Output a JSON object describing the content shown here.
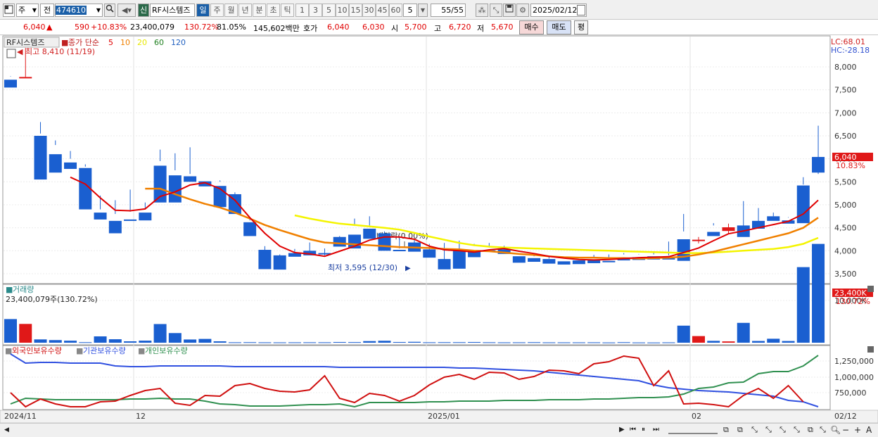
{
  "toolbar": {
    "period_ju": "주",
    "jeon": "전",
    "code": "474610",
    "sin": "신",
    "name": "RF시스템즈",
    "periods": [
      "일",
      "주",
      "월",
      "년",
      "분",
      "초",
      "틱"
    ],
    "minutes": [
      "1",
      "3",
      "5",
      "10",
      "15",
      "30",
      "45",
      "60"
    ],
    "minute_value": "5",
    "count": "55/55",
    "date": "2025/02/12"
  },
  "info": {
    "price": "6,040",
    "change": "590",
    "change_pct": "+10.83%",
    "volume": "23,400,079",
    "vol_ratio": "130.72%",
    "strength": "81.05%",
    "amount": "145,602백만",
    "hoga_label": "호가",
    "ask": "6,040",
    "bid": "6,030",
    "open_label": "시",
    "open": "5,700",
    "high_label": "고",
    "high": "6,720",
    "low_label": "저",
    "low": "5,670",
    "buy": "매수",
    "sell": "매도",
    "avg": "평"
  },
  "legend": {
    "name": "RF시스템즈",
    "ma_prefix": "종가 단순",
    "ma": [
      {
        "label": "5",
        "color": "#e00000"
      },
      {
        "label": "10",
        "color": "#f08000"
      },
      {
        "label": "20",
        "color": "#e8e800"
      },
      {
        "label": "60",
        "color": "#208020"
      },
      {
        "label": "120",
        "color": "#2060c0"
      }
    ],
    "max_label": "최고 8,410 (11/19)",
    "min_label": "최저 3,595 (12/30)",
    "dividend": "배당락(0.00%)",
    "lc": "LC:68.01",
    "hc": "HC:-28.18",
    "last_price": "6,040",
    "last_pct": "10.83%"
  },
  "volume_panel": {
    "title": "거래량",
    "value": "23,400,079주(130.72%)",
    "badge": "23,400K",
    "pct": "130.72%",
    "tick": "10,000K"
  },
  "holdings": {
    "foreign": "외국인보유수량",
    "institution": "기관보유수량",
    "individual": "개인보유수량",
    "ticks": [
      "1,250,000",
      "1,000,000",
      "750,000"
    ],
    "colors": {
      "foreign": "#d01010",
      "institution": "#3050e0",
      "individual": "#309050"
    }
  },
  "xaxis": {
    "labels": [
      "2024/11",
      "12",
      "2025/01",
      "02"
    ],
    "end": "02/12"
  },
  "price_axis": [
    "8,000",
    "7,500",
    "7,000",
    "6,500",
    "6,000",
    "5,500",
    "5,000",
    "4,500",
    "4,000",
    "3,500"
  ],
  "colors": {
    "up": "#e01818",
    "down": "#1a5fd0",
    "ma5": "#e00000",
    "ma10": "#f08000",
    "ma20": "#f4f400"
  },
  "chart_data": {
    "type": "candlestick",
    "candles": [
      [
        7720,
        7800,
        7790,
        7550
      ],
      [
        7750,
        8410,
        7780,
        7780
      ],
      [
        6500,
        6800,
        6550,
        5550
      ],
      [
        6100,
        6300,
        6400,
        5700
      ],
      [
        5920,
        6000,
        6170,
        5780
      ],
      [
        5800,
        5880,
        5830,
        4900
      ],
      [
        4830,
        5200,
        4900,
        4680
      ],
      [
        4650,
        5100,
        4800,
        4380
      ],
      [
        4680,
        5330,
        4850,
        4650
      ],
      [
        4830,
        5050,
        4920,
        4660
      ],
      [
        5850,
        6200,
        5950,
        5050
      ],
      [
        5640,
        6120,
        5750,
        5050
      ],
      [
        5620,
        6250,
        5670,
        5500
      ],
      [
        5510,
        5550,
        5550,
        5400
      ],
      [
        5410,
        5500,
        5530,
        4950
      ],
      [
        5230,
        5270,
        5230,
        4800
      ],
      [
        4620,
        4660,
        4700,
        4320
      ],
      [
        4020,
        4100,
        4000,
        3600
      ],
      [
        3900,
        3920,
        3680,
        3590
      ],
      [
        3950,
        4040,
        3910,
        3870
      ],
      [
        4000,
        4180,
        3910,
        3900
      ],
      [
        3950,
        4050,
        3900,
        3920
      ],
      [
        4300,
        4320,
        4290,
        4090
      ],
      [
        4350,
        4700,
        4540,
        4050
      ],
      [
        4480,
        4550,
        4750,
        4260
      ],
      [
        4380,
        4420,
        4390,
        4000
      ],
      [
        4020,
        4050,
        4270,
        4000
      ],
      [
        4180,
        4250,
        4170,
        3980
      ],
      [
        4030,
        4150,
        3900,
        3850
      ],
      [
        3820,
        4170,
        3670,
        3595
      ],
      [
        4000,
        4220,
        3970,
        3610
      ],
      [
        4000,
        4120,
        4150,
        3860
      ],
      [
        4010,
        4170,
        4070,
        3990
      ],
      [
        4030,
        4110,
        3960,
        3930
      ],
      [
        3880,
        3940,
        3920,
        3740
      ],
      [
        3840,
        3910,
        3880,
        3760
      ],
      [
        3820,
        3830,
        3860,
        3720
      ],
      [
        3770,
        3860,
        3850,
        3700
      ],
      [
        3790,
        3830,
        3830,
        3710
      ],
      [
        3800,
        3910,
        3850,
        3730
      ],
      [
        3780,
        3920,
        3850,
        3760
      ],
      [
        3840,
        3920,
        3950,
        3790
      ],
      [
        3860,
        3930,
        3920,
        3800
      ],
      [
        3880,
        3980,
        3920,
        3810
      ],
      [
        3840,
        4200,
        3900,
        3810
      ],
      [
        4250,
        4800,
        4420,
        3780
      ],
      [
        4220,
        4300,
        4160,
        4240
      ],
      [
        4410,
        4600,
        4550,
        4320
      ],
      [
        4430,
        4590,
        4360,
        4510
      ],
      [
        4550,
        5080,
        4500,
        4300
      ],
      [
        4650,
        4930,
        4480,
        4480
      ],
      [
        4750,
        4750,
        4830,
        4650
      ],
      [
        4660,
        4730,
        4720,
        4590
      ],
      [
        5420,
        5440,
        5600,
        4600
      ],
      [
        6040,
        6720,
        5670,
        5700
      ]
    ],
    "volume_k": [
      5600,
      4450,
      780,
      620,
      480,
      120,
      1500,
      820,
      330,
      490,
      4420,
      2280,
      760,
      900,
      330,
      100,
      120,
      90,
      80,
      90,
      100,
      100,
      160,
      140,
      380,
      460,
      160,
      210,
      100,
      120,
      120,
      160,
      100,
      80,
      90,
      120,
      80,
      80,
      80,
      90,
      60,
      120,
      60,
      50,
      80,
      4040,
      1570,
      440,
      310,
      4700,
      410,
      940,
      400,
      17900,
      23400
    ],
    "ma5": [
      [
        4,
        5600
      ],
      [
        5,
        5450
      ],
      [
        6,
        5150
      ],
      [
        7,
        4880
      ],
      [
        8,
        4870
      ],
      [
        9,
        4910
      ],
      [
        10,
        5180
      ],
      [
        11,
        5280
      ],
      [
        12,
        5430
      ],
      [
        13,
        5480
      ],
      [
        14,
        5350
      ],
      [
        15,
        5100
      ],
      [
        16,
        4720
      ],
      [
        17,
        4380
      ],
      [
        18,
        4100
      ],
      [
        19,
        3960
      ],
      [
        20,
        3930
      ],
      [
        21,
        3880
      ],
      [
        22,
        3990
      ],
      [
        23,
        4100
      ],
      [
        24,
        4230
      ],
      [
        25,
        4300
      ],
      [
        26,
        4300
      ],
      [
        27,
        4250
      ],
      [
        28,
        4100
      ],
      [
        29,
        4020
      ],
      [
        30,
        4000
      ],
      [
        31,
        3970
      ],
      [
        32,
        4020
      ],
      [
        33,
        4050
      ],
      [
        34,
        3990
      ],
      [
        35,
        3940
      ],
      [
        36,
        3880
      ],
      [
        37,
        3840
      ],
      [
        38,
        3810
      ],
      [
        39,
        3800
      ],
      [
        40,
        3810
      ],
      [
        41,
        3830
      ],
      [
        42,
        3850
      ],
      [
        43,
        3860
      ],
      [
        44,
        3870
      ],
      [
        45,
        3960
      ],
      [
        46,
        4060
      ],
      [
        47,
        4220
      ],
      [
        48,
        4370
      ],
      [
        49,
        4430
      ],
      [
        50,
        4500
      ],
      [
        51,
        4570
      ],
      [
        52,
        4640
      ],
      [
        53,
        4800
      ],
      [
        54,
        5100
      ]
    ],
    "ma10": [
      [
        9,
        5350
      ],
      [
        10,
        5350
      ],
      [
        11,
        5230
      ],
      [
        12,
        5120
      ],
      [
        13,
        5020
      ],
      [
        14,
        4940
      ],
      [
        15,
        4830
      ],
      [
        16,
        4700
      ],
      [
        17,
        4560
      ],
      [
        18,
        4450
      ],
      [
        19,
        4350
      ],
      [
        20,
        4250
      ],
      [
        21,
        4180
      ],
      [
        22,
        4160
      ],
      [
        23,
        4140
      ],
      [
        24,
        4120
      ],
      [
        25,
        4100
      ],
      [
        26,
        4080
      ],
      [
        27,
        4070
      ],
      [
        28,
        4060
      ],
      [
        29,
        4040
      ],
      [
        30,
        4030
      ],
      [
        31,
        4000
      ],
      [
        32,
        3990
      ],
      [
        33,
        3960
      ],
      [
        34,
        3930
      ],
      [
        35,
        3910
      ],
      [
        36,
        3880
      ],
      [
        37,
        3860
      ],
      [
        38,
        3850
      ],
      [
        39,
        3850
      ],
      [
        40,
        3840
      ],
      [
        41,
        3840
      ],
      [
        42,
        3830
      ],
      [
        43,
        3840
      ],
      [
        44,
        3850
      ],
      [
        45,
        3870
      ],
      [
        46,
        3920
      ],
      [
        47,
        3980
      ],
      [
        48,
        4060
      ],
      [
        49,
        4140
      ],
      [
        50,
        4220
      ],
      [
        51,
        4300
      ],
      [
        52,
        4380
      ],
      [
        53,
        4500
      ],
      [
        54,
        4720
      ]
    ],
    "ma20": [
      [
        19,
        4770
      ],
      [
        20,
        4700
      ],
      [
        21,
        4640
      ],
      [
        22,
        4590
      ],
      [
        23,
        4560
      ],
      [
        24,
        4530
      ],
      [
        25,
        4500
      ],
      [
        26,
        4460
      ],
      [
        27,
        4390
      ],
      [
        28,
        4310
      ],
      [
        29,
        4240
      ],
      [
        30,
        4170
      ],
      [
        31,
        4120
      ],
      [
        32,
        4090
      ],
      [
        33,
        4070
      ],
      [
        34,
        4060
      ],
      [
        35,
        4050
      ],
      [
        36,
        4040
      ],
      [
        37,
        4030
      ],
      [
        38,
        4020
      ],
      [
        39,
        4010
      ],
      [
        40,
        4000
      ],
      [
        41,
        3990
      ],
      [
        42,
        3980
      ],
      [
        43,
        3970
      ],
      [
        44,
        3960
      ],
      [
        45,
        3950
      ],
      [
        46,
        3950
      ],
      [
        47,
        3960
      ],
      [
        48,
        3980
      ],
      [
        49,
        4000
      ],
      [
        50,
        4020
      ],
      [
        51,
        4040
      ],
      [
        52,
        4080
      ],
      [
        53,
        4150
      ],
      [
        54,
        4280
      ]
    ]
  }
}
